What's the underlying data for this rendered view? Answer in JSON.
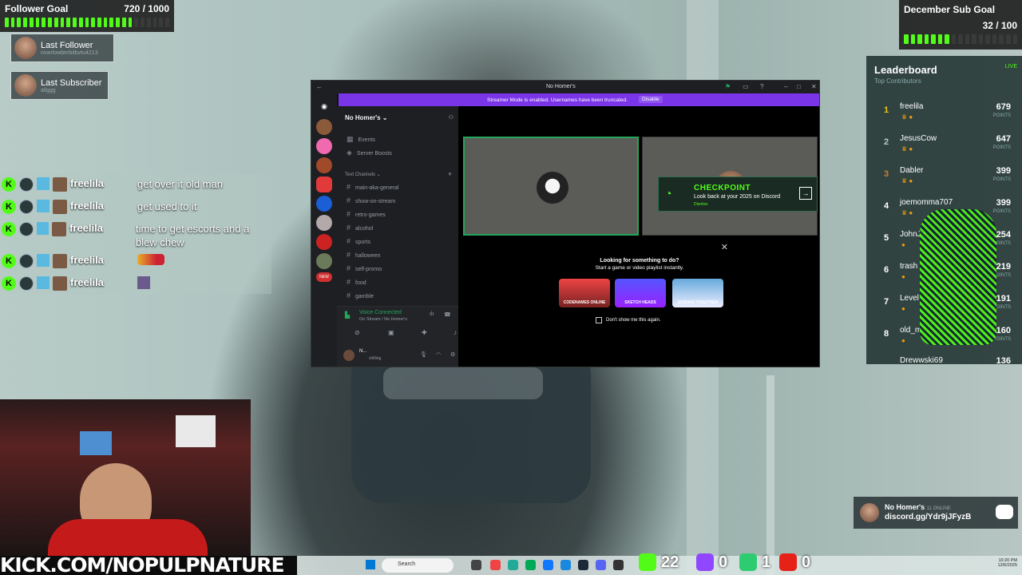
{
  "overlay": {
    "follower_goal": {
      "label": "Follower Goal",
      "value": "720 / 1000"
    },
    "sub_goal": {
      "label": "December Sub Goal",
      "value": "32 / 100"
    },
    "last_follower": {
      "label": "Last Follower",
      "name": "nvwrlowberbitbvtu4213"
    },
    "last_subscriber": {
      "label": "Last Subscriber",
      "name": "allggg"
    },
    "kick_url": "KICK.COM/NOPULPNATURE",
    "discord_invite": {
      "server": "No Homer's",
      "online": "11 ONLINE",
      "link": "discord.gg/Ydr9jJFyzB"
    }
  },
  "chat": [
    {
      "user": "freelila",
      "message": "get over it old man"
    },
    {
      "user": "freelila",
      "message": "get used to it"
    },
    {
      "user": "freelila",
      "message": "time to get escorts and a blew chew"
    },
    {
      "user": "freelila",
      "message": "",
      "emote": true
    },
    {
      "user": "freelila",
      "message": "",
      "emote2": true
    }
  ],
  "leaderboard": {
    "title": "Leaderboard",
    "subtitle": "Top Contributors",
    "live": "LIVE",
    "points_label": "POINTS",
    "rows": [
      {
        "rank": "1",
        "name": "freelila",
        "points": "679"
      },
      {
        "rank": "2",
        "name": "JesusCow",
        "points": "647"
      },
      {
        "rank": "3",
        "name": "Dabler",
        "points": "399"
      },
      {
        "rank": "4",
        "name": "joemomma707",
        "points": "399"
      },
      {
        "rank": "5",
        "name": "JohnJu",
        "points": "254"
      },
      {
        "rank": "6",
        "name": "trash",
        "points": "219"
      },
      {
        "rank": "7",
        "name": "Level",
        "points": "191"
      },
      {
        "rank": "8",
        "name": "old_m",
        "points": "160"
      },
      {
        "rank": "",
        "name": "Drewwski69",
        "points": "136"
      }
    ]
  },
  "discord": {
    "window_title": "No Homer's",
    "banner_text": "Streamer Mode is enabled. Usernames have been truncated.",
    "banner_button": "Disable",
    "server_name": "No Homer's",
    "top_items": [
      "Events",
      "Server Boosts"
    ],
    "category": "Text Channels",
    "channels": [
      "main-aka-general",
      "show-on-stream",
      "retro-games",
      "alcohol",
      "sports",
      "halloween",
      "self-promo",
      "food",
      "gamble"
    ],
    "voice_status": "Voice Connected",
    "voice_channel": "On Stream / No Homer's",
    "user_name": "N...",
    "user_status": "chilling",
    "guild_badge_new": "NEW",
    "checkpoint": {
      "title": "CHECKPOINT",
      "desc": "Look back at your 2025 on Discord",
      "sub": "Dismiss"
    },
    "activity": {
      "title": "Looking for something to do?",
      "subtitle": "Start a game or video playlist instantly.",
      "games": [
        "CODENAMES ONLINE",
        "SKETCH HEADS",
        "SUDOKU TOGETHER"
      ],
      "checkbox_label": "Don't show me this again."
    }
  },
  "taskbar": {
    "search": "Search",
    "time": "10:20 PM",
    "date": "12/6/2025"
  },
  "stats": {
    "kick": "22",
    "twitch": "0",
    "followers": "1",
    "youtube": "0"
  },
  "colors": {
    "kick_green": "#53fc18",
    "discord_purple": "#7b35e8",
    "speaking_green": "#23a55a"
  }
}
